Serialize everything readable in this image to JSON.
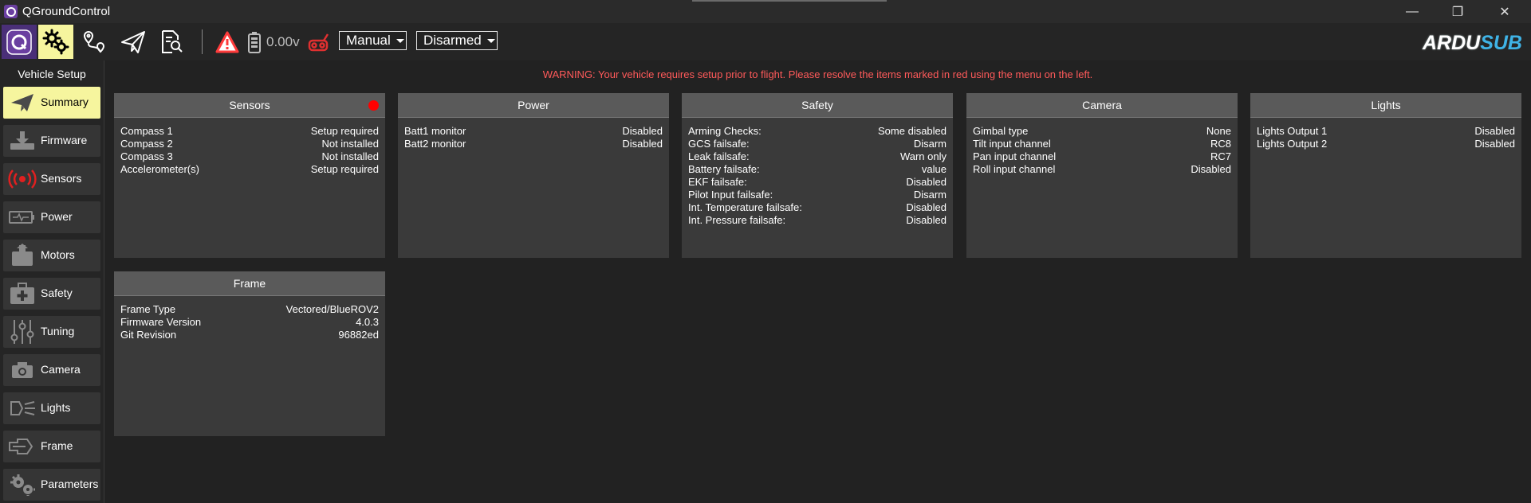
{
  "window": {
    "title": "QGroundControl",
    "controls": {
      "minimize": "—",
      "restore": "❐",
      "close": "✕"
    }
  },
  "toolbar": {
    "battery_voltage": "0.00v",
    "flight_mode": "Manual",
    "arm_state": "Disarmed",
    "brand_part1": "ARDU",
    "brand_part2": "SUB",
    "icons": [
      "qgc-logo-icon",
      "gear-icon",
      "plan-route-icon",
      "fly-paper-plane-icon",
      "analyze-document-icon",
      "warning-triangle-icon",
      "battery-icon",
      "rc-signal-icon"
    ],
    "colors": {
      "active": "#f6f59e",
      "warning": "#ff3b3b",
      "brand_blue": "#3fb3e6"
    }
  },
  "sidebar": {
    "title": "Vehicle Setup",
    "items": [
      {
        "label": "Summary",
        "icon": "paper-plane-icon",
        "active": true
      },
      {
        "label": "Firmware",
        "icon": "download-tray-icon",
        "active": false
      },
      {
        "label": "Sensors",
        "icon": "radio-waves-icon",
        "active": false
      },
      {
        "label": "Power",
        "icon": "battery-pulse-icon",
        "active": false
      },
      {
        "label": "Motors",
        "icon": "motor-icon",
        "active": false
      },
      {
        "label": "Safety",
        "icon": "first-aid-kit-icon",
        "active": false
      },
      {
        "label": "Tuning",
        "icon": "sliders-icon",
        "active": false
      },
      {
        "label": "Camera",
        "icon": "camera-icon",
        "active": false
      },
      {
        "label": "Lights",
        "icon": "lights-icon",
        "active": false
      },
      {
        "label": "Frame",
        "icon": "frame-icon",
        "active": false
      },
      {
        "label": "Parameters",
        "icon": "gears-icon",
        "active": false
      }
    ]
  },
  "main": {
    "warning": "WARNING: Your vehicle requires setup prior to flight. Please resolve the items marked in red using the menu on the left.",
    "cards": {
      "sensors": {
        "title": "Sensors",
        "needs_setup": true,
        "rows": [
          {
            "label": "Compass 1",
            "value": "Setup required"
          },
          {
            "label": "Compass 2",
            "value": "Not installed"
          },
          {
            "label": "Compass 3",
            "value": "Not installed"
          },
          {
            "label": "Accelerometer(s)",
            "value": "Setup required"
          }
        ]
      },
      "power": {
        "title": "Power",
        "rows": [
          {
            "label": "Batt1 monitor",
            "value": "Disabled"
          },
          {
            "label": "Batt2 monitor",
            "value": "Disabled"
          }
        ]
      },
      "safety": {
        "title": "Safety",
        "rows": [
          {
            "label": "Arming Checks:",
            "value": "Some disabled"
          },
          {
            "label": "GCS failsafe:",
            "value": "Disarm"
          },
          {
            "label": "Leak failsafe:",
            "value": "Warn only"
          },
          {
            "label": "Battery failsafe:",
            "value": "value"
          },
          {
            "label": "EKF failsafe:",
            "value": "Disabled"
          },
          {
            "label": "Pilot Input failsafe:",
            "value": "Disarm"
          },
          {
            "label": "Int. Temperature failsafe:",
            "value": "Disabled"
          },
          {
            "label": "Int. Pressure failsafe:",
            "value": "Disabled"
          }
        ]
      },
      "camera": {
        "title": "Camera",
        "rows": [
          {
            "label": "Gimbal type",
            "value": "None"
          },
          {
            "label": "Tilt input channel",
            "value": "RC8"
          },
          {
            "label": "Pan input channel",
            "value": "RC7"
          },
          {
            "label": "Roll input channel",
            "value": "Disabled"
          }
        ]
      },
      "lights": {
        "title": "Lights",
        "rows": [
          {
            "label": "Lights Output 1",
            "value": "Disabled"
          },
          {
            "label": "Lights Output 2",
            "value": "Disabled"
          }
        ]
      },
      "frame": {
        "title": "Frame",
        "rows": [
          {
            "label": "Frame Type",
            "value": "Vectored/BlueROV2"
          },
          {
            "label": "Firmware Version",
            "value": "4.0.3 "
          },
          {
            "label": "Git Revision",
            "value": "96882ed"
          }
        ]
      }
    }
  }
}
